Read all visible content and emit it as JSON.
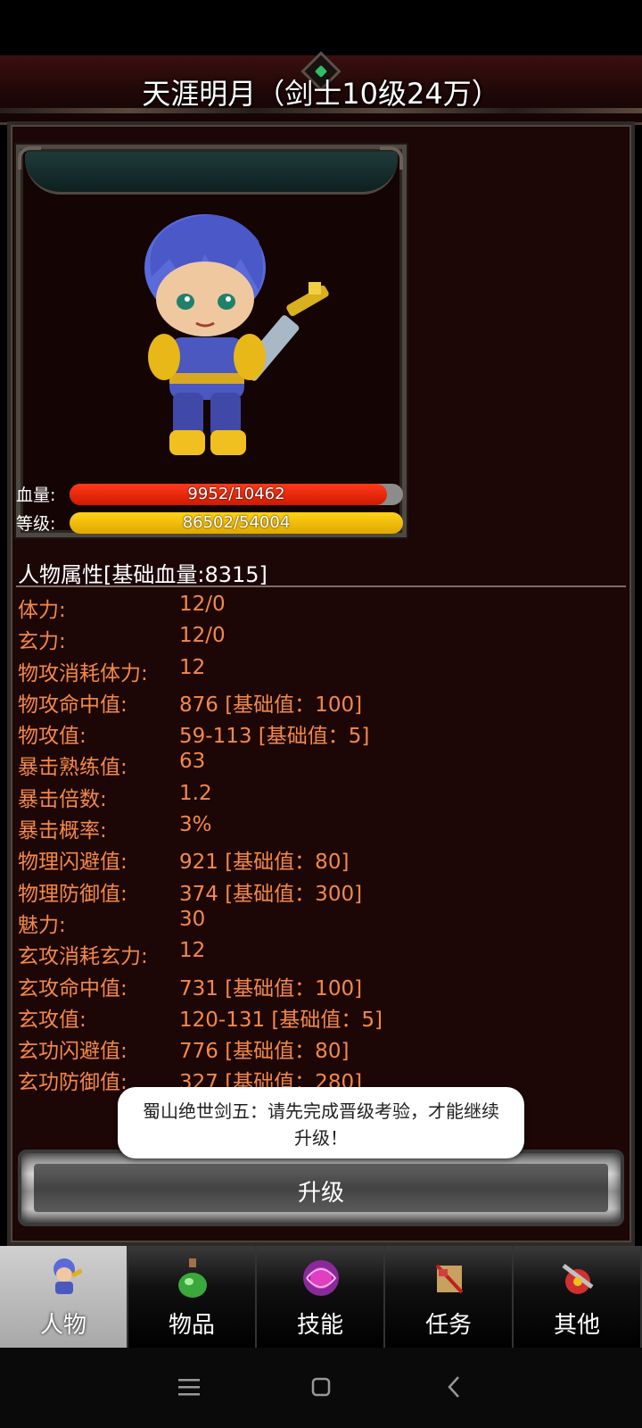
{
  "header": {
    "title": "天涯明月（剑士10级24万）"
  },
  "character": {
    "hp_label": "血量:",
    "hp_text": "9952/10462",
    "hp_fraction": 0.951,
    "level_label": "等级:",
    "exp_text": "86502/54004",
    "exp_fraction": 1.0
  },
  "attributes": {
    "section_title": "人物属性[基础血量:8315]",
    "rows": [
      {
        "k": "体力:",
        "v": "12/0"
      },
      {
        "k": "玄力:",
        "v": "12/0"
      },
      {
        "k": "物攻消耗体力:",
        "v": "12"
      },
      {
        "k": "物攻命中值:",
        "v": "876 [基础值：100]"
      },
      {
        "k": "物攻值:",
        "v": "59-113 [基础值：5]"
      },
      {
        "k": "暴击熟练值:",
        "v": "63"
      },
      {
        "k": "暴击倍数:",
        "v": "1.2"
      },
      {
        "k": "暴击概率:",
        "v": "3%"
      },
      {
        "k": "物理闪避值:",
        "v": "921 [基础值：80]"
      },
      {
        "k": "物理防御值:",
        "v": "374 [基础值：300]"
      },
      {
        "k": "魅力:",
        "v": "30"
      },
      {
        "k": "玄攻消耗玄力:",
        "v": "12"
      },
      {
        "k": "玄攻命中值:",
        "v": "731 [基础值：100]"
      },
      {
        "k": "玄攻值:",
        "v": "120-131 [基础值：5]"
      },
      {
        "k": "玄功闪避值:",
        "v": "776 [基础值：80]"
      },
      {
        "k": "玄功防御值:",
        "v": "327 [基础值：280]"
      }
    ]
  },
  "toast": {
    "message": "蜀山绝世剑五：请先完成晋级考验，才能继续升级！"
  },
  "upgrade_button": {
    "label": "升级"
  },
  "tabs": [
    {
      "label": "人物",
      "icon": "character-icon",
      "active": true
    },
    {
      "label": "物品",
      "icon": "potion-icon",
      "active": false
    },
    {
      "label": "技能",
      "icon": "skill-orb-icon",
      "active": false
    },
    {
      "label": "任务",
      "icon": "quest-icon",
      "active": false
    },
    {
      "label": "其他",
      "icon": "other-icon",
      "active": false
    }
  ],
  "colors": {
    "attribute_text": "#f3894a",
    "hp_bar": "#e8210d",
    "exp_bar": "#f3c00e",
    "panel_bg": "#1d0606"
  }
}
